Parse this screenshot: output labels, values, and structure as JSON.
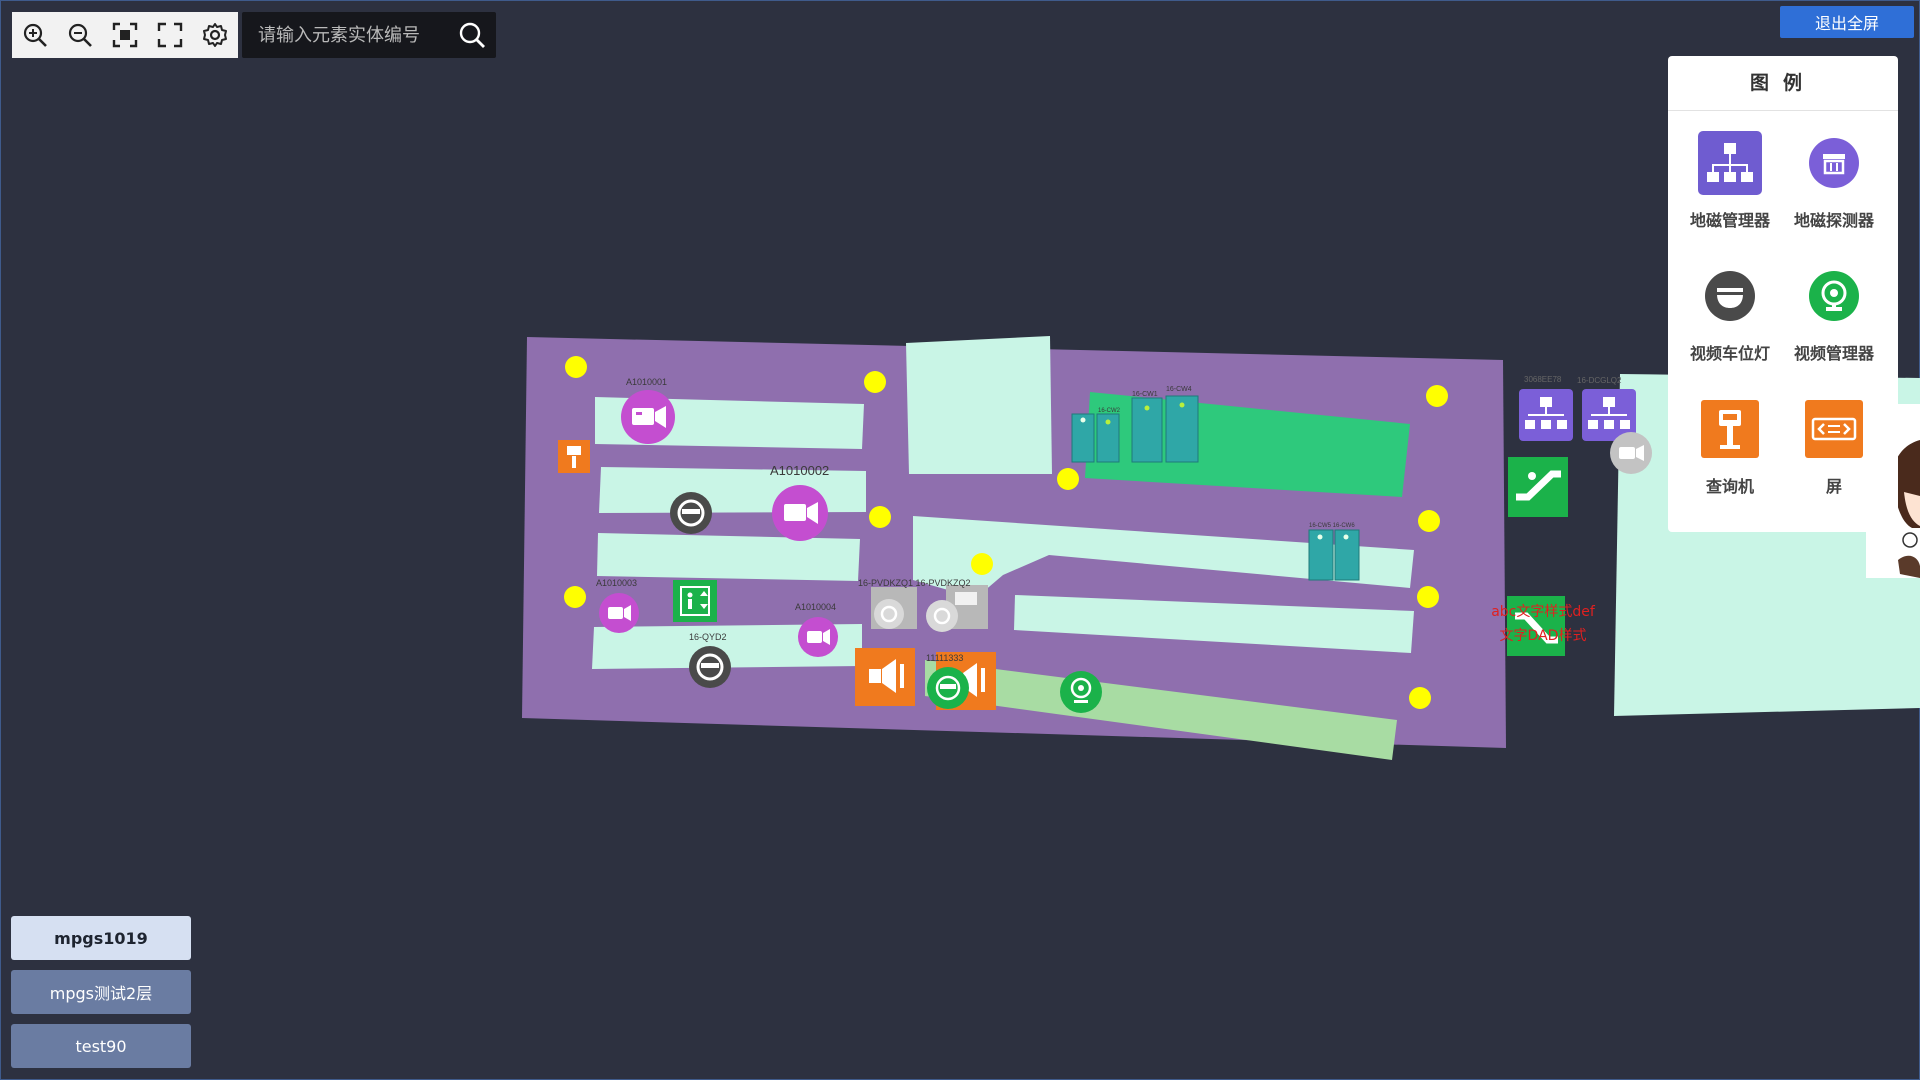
{
  "toolbar": {
    "zoom_in": "zoom-in-icon",
    "zoom_out": "zoom-out-icon",
    "fit": "fit-screen-icon",
    "fullscreen": "fullscreen-icon",
    "settings": "gear-icon"
  },
  "search": {
    "placeholder": "请输入元素实体编号"
  },
  "exit_fullscreen_label": "退出全屏",
  "legend": {
    "title": "图例",
    "items": [
      {
        "label": "地磁管理器",
        "icon": "network-hub-icon",
        "color": "#6f5cd0"
      },
      {
        "label": "地磁探测器",
        "icon": "detector-icon",
        "color": "#7b5fd8"
      },
      {
        "label": "视频车位灯",
        "icon": "dome-light-icon",
        "color": "#4a4a4a"
      },
      {
        "label": "视频管理器",
        "icon": "webcam-icon",
        "color": "#1bb24a"
      },
      {
        "label": "查询机",
        "icon": "kiosk-icon",
        "color": "#f07a1e"
      },
      {
        "label": "屏",
        "icon": "screen-icon",
        "color": "#f07a1e"
      }
    ]
  },
  "floors": [
    {
      "label": "mpgs1019",
      "active": true
    },
    {
      "label": "mpgs测试2层",
      "active": false
    },
    {
      "label": "test90",
      "active": false
    }
  ],
  "map_labels": {
    "cam1": "A1010001",
    "cam2": "A1010002",
    "cam3": "A1010003",
    "cam4": "A1010004",
    "qyd2": "16-QYD2",
    "pvd": "16-PVDKZQ1 16-PVDKZQ2",
    "id11": "11111333",
    "cw1": "16-CW1",
    "cw2": "16-CW2",
    "cw4": "16-CW4",
    "cw5": "16-CW5 16-CW6",
    "hub1": "3068EE78",
    "hub2": "16-DCGLQ2"
  },
  "red_text": {
    "line1": "abc文字样式def",
    "line2": "文字DAD样式"
  },
  "colors": {
    "background": "#2d3140",
    "floor_fill": "#8f6fae",
    "aisle": "#c9f5e6",
    "green_zone": "#2ec97c",
    "light_green": "#a8dca3",
    "spot_yellow": "#ffff00"
  }
}
